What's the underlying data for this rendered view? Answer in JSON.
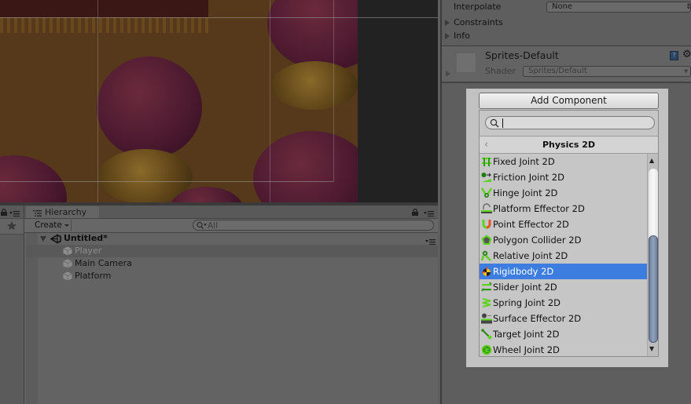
{
  "inspector": {
    "interpolate_label": "Interpolate",
    "interpolate_value": "None",
    "constraints_label": "Constraints",
    "info_label": "Info",
    "material_name": "Sprites-Default",
    "shader_label": "Shader",
    "shader_value": "Sprites/Default"
  },
  "hierarchy": {
    "tab_label": "Hierarchy",
    "create_label": "Create",
    "search_placeholder": "All",
    "scene_name": "Untitled*",
    "objects": [
      {
        "name": "Player",
        "selected": true
      },
      {
        "name": "Main Camera",
        "selected": false
      },
      {
        "name": "Platform",
        "selected": false
      }
    ]
  },
  "add_component": {
    "button_label": "Add Component",
    "search_value": "",
    "category_title": "Physics 2D",
    "items": [
      {
        "label": "Fixed Joint 2D",
        "icon": "fixed-joint-icon"
      },
      {
        "label": "Friction Joint 2D",
        "icon": "friction-joint-icon"
      },
      {
        "label": "Hinge Joint 2D",
        "icon": "hinge-joint-icon"
      },
      {
        "label": "Platform Effector 2D",
        "icon": "platform-effector-icon"
      },
      {
        "label": "Point Effector 2D",
        "icon": "point-effector-icon"
      },
      {
        "label": "Polygon Collider 2D",
        "icon": "polygon-collider-icon"
      },
      {
        "label": "Relative Joint 2D",
        "icon": "relative-joint-icon"
      },
      {
        "label": "Rigidbody 2D",
        "icon": "rigidbody-icon",
        "selected": true
      },
      {
        "label": "Slider Joint 2D",
        "icon": "slider-joint-icon"
      },
      {
        "label": "Spring Joint 2D",
        "icon": "spring-joint-icon"
      },
      {
        "label": "Surface Effector 2D",
        "icon": "surface-effector-icon"
      },
      {
        "label": "Target Joint 2D",
        "icon": "target-joint-icon"
      },
      {
        "label": "Wheel Joint 2D",
        "icon": "wheel-joint-icon"
      }
    ]
  },
  "colors": {
    "selection": "#3d7de0",
    "physics_icon_green": "#5fd11f"
  }
}
